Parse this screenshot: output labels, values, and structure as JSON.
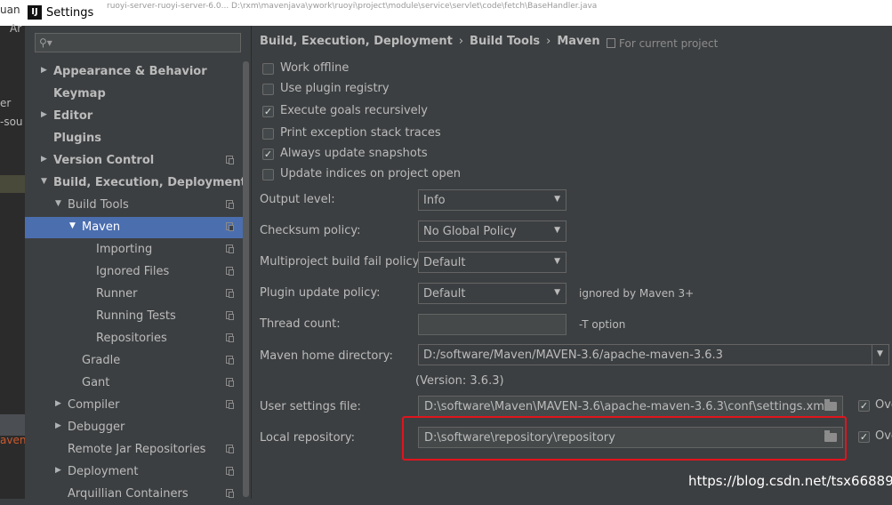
{
  "window": {
    "app_icon": "IJ",
    "title": "Settings",
    "background_title": "uan",
    "background_url": "ruoyi-server-ruoyi-server-6.0... D:\\rxm\\mavenjava\\ywork\\ruoyi\\project\\module\\service\\servlet\\code\\fetch\\BaseHandler.java"
  },
  "background_ide": [
    "Ar",
    "er",
    "-sou",
    "aven"
  ],
  "sidebar": {
    "search_placeholder": "",
    "items": [
      {
        "label": "Appearance & Behavior",
        "bold": true,
        "arrow": "right",
        "indent": 0,
        "proj": false
      },
      {
        "label": "Keymap",
        "bold": true,
        "arrow": "",
        "indent": 0,
        "proj": false
      },
      {
        "label": "Editor",
        "bold": true,
        "arrow": "right",
        "indent": 0,
        "proj": false
      },
      {
        "label": "Plugins",
        "bold": true,
        "arrow": "",
        "indent": 0,
        "proj": false
      },
      {
        "label": "Version Control",
        "bold": true,
        "arrow": "right",
        "indent": 0,
        "proj": true
      },
      {
        "label": "Build, Execution, Deployment",
        "bold": true,
        "arrow": "down",
        "indent": 0,
        "proj": false
      },
      {
        "label": "Build Tools",
        "bold": false,
        "arrow": "down",
        "indent": 1,
        "proj": true
      },
      {
        "label": "Maven",
        "bold": false,
        "arrow": "down",
        "indent": 2,
        "proj": true,
        "selected": true
      },
      {
        "label": "Importing",
        "bold": false,
        "arrow": "",
        "indent": 3,
        "proj": true
      },
      {
        "label": "Ignored Files",
        "bold": false,
        "arrow": "",
        "indent": 3,
        "proj": true
      },
      {
        "label": "Runner",
        "bold": false,
        "arrow": "",
        "indent": 3,
        "proj": true
      },
      {
        "label": "Running Tests",
        "bold": false,
        "arrow": "",
        "indent": 3,
        "proj": true
      },
      {
        "label": "Repositories",
        "bold": false,
        "arrow": "",
        "indent": 3,
        "proj": true
      },
      {
        "label": "Gradle",
        "bold": false,
        "arrow": "",
        "indent": 2,
        "proj": true
      },
      {
        "label": "Gant",
        "bold": false,
        "arrow": "",
        "indent": 2,
        "proj": true
      },
      {
        "label": "Compiler",
        "bold": false,
        "arrow": "right",
        "indent": 1,
        "proj": true
      },
      {
        "label": "Debugger",
        "bold": false,
        "arrow": "right",
        "indent": 1,
        "proj": false
      },
      {
        "label": "Remote Jar Repositories",
        "bold": false,
        "arrow": "",
        "indent": 1,
        "proj": true
      },
      {
        "label": "Deployment",
        "bold": false,
        "arrow": "right",
        "indent": 1,
        "proj": true
      },
      {
        "label": "Arquillian Containers",
        "bold": false,
        "arrow": "",
        "indent": 1,
        "proj": true
      }
    ]
  },
  "header": {
    "breadcrumb": [
      "Build, Execution, Deployment",
      "Build Tools",
      "Maven"
    ],
    "breadcrumb_sep": "›",
    "for_project": "For current project"
  },
  "checkboxes": [
    {
      "label": "Work offline",
      "checked": false
    },
    {
      "label": "Use plugin registry",
      "checked": false
    },
    {
      "label": "Execute goals recursively",
      "checked": true
    },
    {
      "label": "Print exception stack traces",
      "checked": false
    },
    {
      "label": "Always update snapshots",
      "checked": true
    },
    {
      "label": "Update indices on project open",
      "checked": false
    }
  ],
  "form": {
    "output_level": {
      "label": "Output level:",
      "value": "Info"
    },
    "checksum_policy": {
      "label": "Checksum policy:",
      "value": "No Global Policy"
    },
    "multiproject_fail_policy": {
      "label": "Multiproject build fail policy:",
      "value": "Default"
    },
    "plugin_update_policy": {
      "label": "Plugin update policy:",
      "value": "Default",
      "note": "ignored by Maven 3+"
    },
    "thread_count": {
      "label": "Thread count:",
      "value": "",
      "note": "-T option"
    },
    "maven_home": {
      "label": "Maven home directory:",
      "value": "D:/software/Maven/MAVEN-3.6/apache-maven-3.6.3",
      "version": "(Version: 3.6.3)"
    },
    "user_settings": {
      "label": "User settings file:",
      "value": "D:\\software\\Maven\\MAVEN-3.6\\apache-maven-3.6.3\\conf\\settings.xml",
      "override_label": "Ove",
      "override_checked": true
    },
    "local_repo": {
      "label": "Local repository:",
      "value": "D:\\software\\repository\\repository",
      "override_label": "Ove",
      "override_checked": true
    }
  },
  "watermark": "https://blog.csdn.net/tsx668899",
  "colors": {
    "selection": "#4b6eaf",
    "highlight_box": "#e0141e",
    "panel": "#3c3f41"
  }
}
